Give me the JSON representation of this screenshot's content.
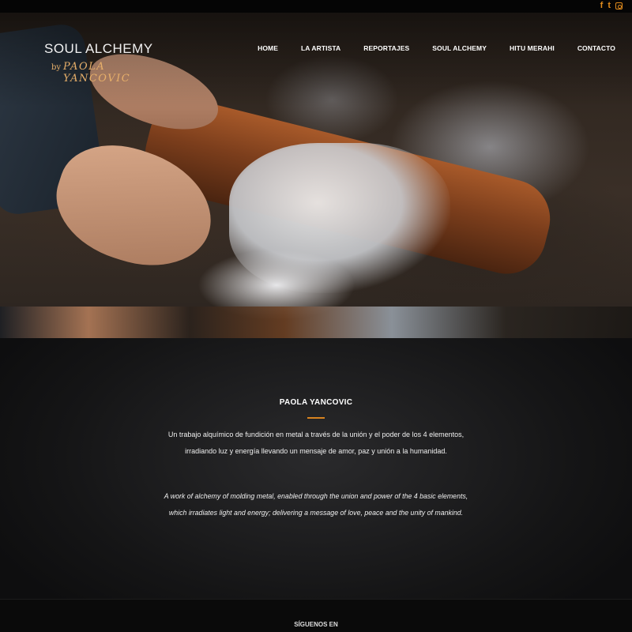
{
  "social": {
    "facebook": "f",
    "twitter": "t",
    "icons": [
      "facebook-icon",
      "twitter-icon",
      "instagram-icon"
    ],
    "color": "#e08b1c"
  },
  "logo": {
    "title": "SOUL ALCHEMY",
    "by": "by",
    "name": "PAOLA YANCOVIC"
  },
  "nav": [
    "HOME",
    "LA ARTISTA",
    "REPORTAJES",
    "SOUL ALCHEMY",
    "HITU MERAHI",
    "CONTACTO"
  ],
  "main": {
    "title": "PAOLA YANCOVIC",
    "accent": "#d8831f",
    "spanish_line1": "Un trabajo alquímico de fundición en metal a través de la unión y el poder de los 4 elementos,",
    "spanish_line2": "irradiando luz y energía llevando un mensaje de amor, paz y unión a la humanidad.",
    "english_line1": "A work of alchemy of molding metal, enabled through the union and power of the 4 basic elements,",
    "english_line2": "which irradiates light and energy; delivering a message of love, peace and the unity of mankind."
  },
  "footer": {
    "follow": "SÍGUENOS EN"
  }
}
